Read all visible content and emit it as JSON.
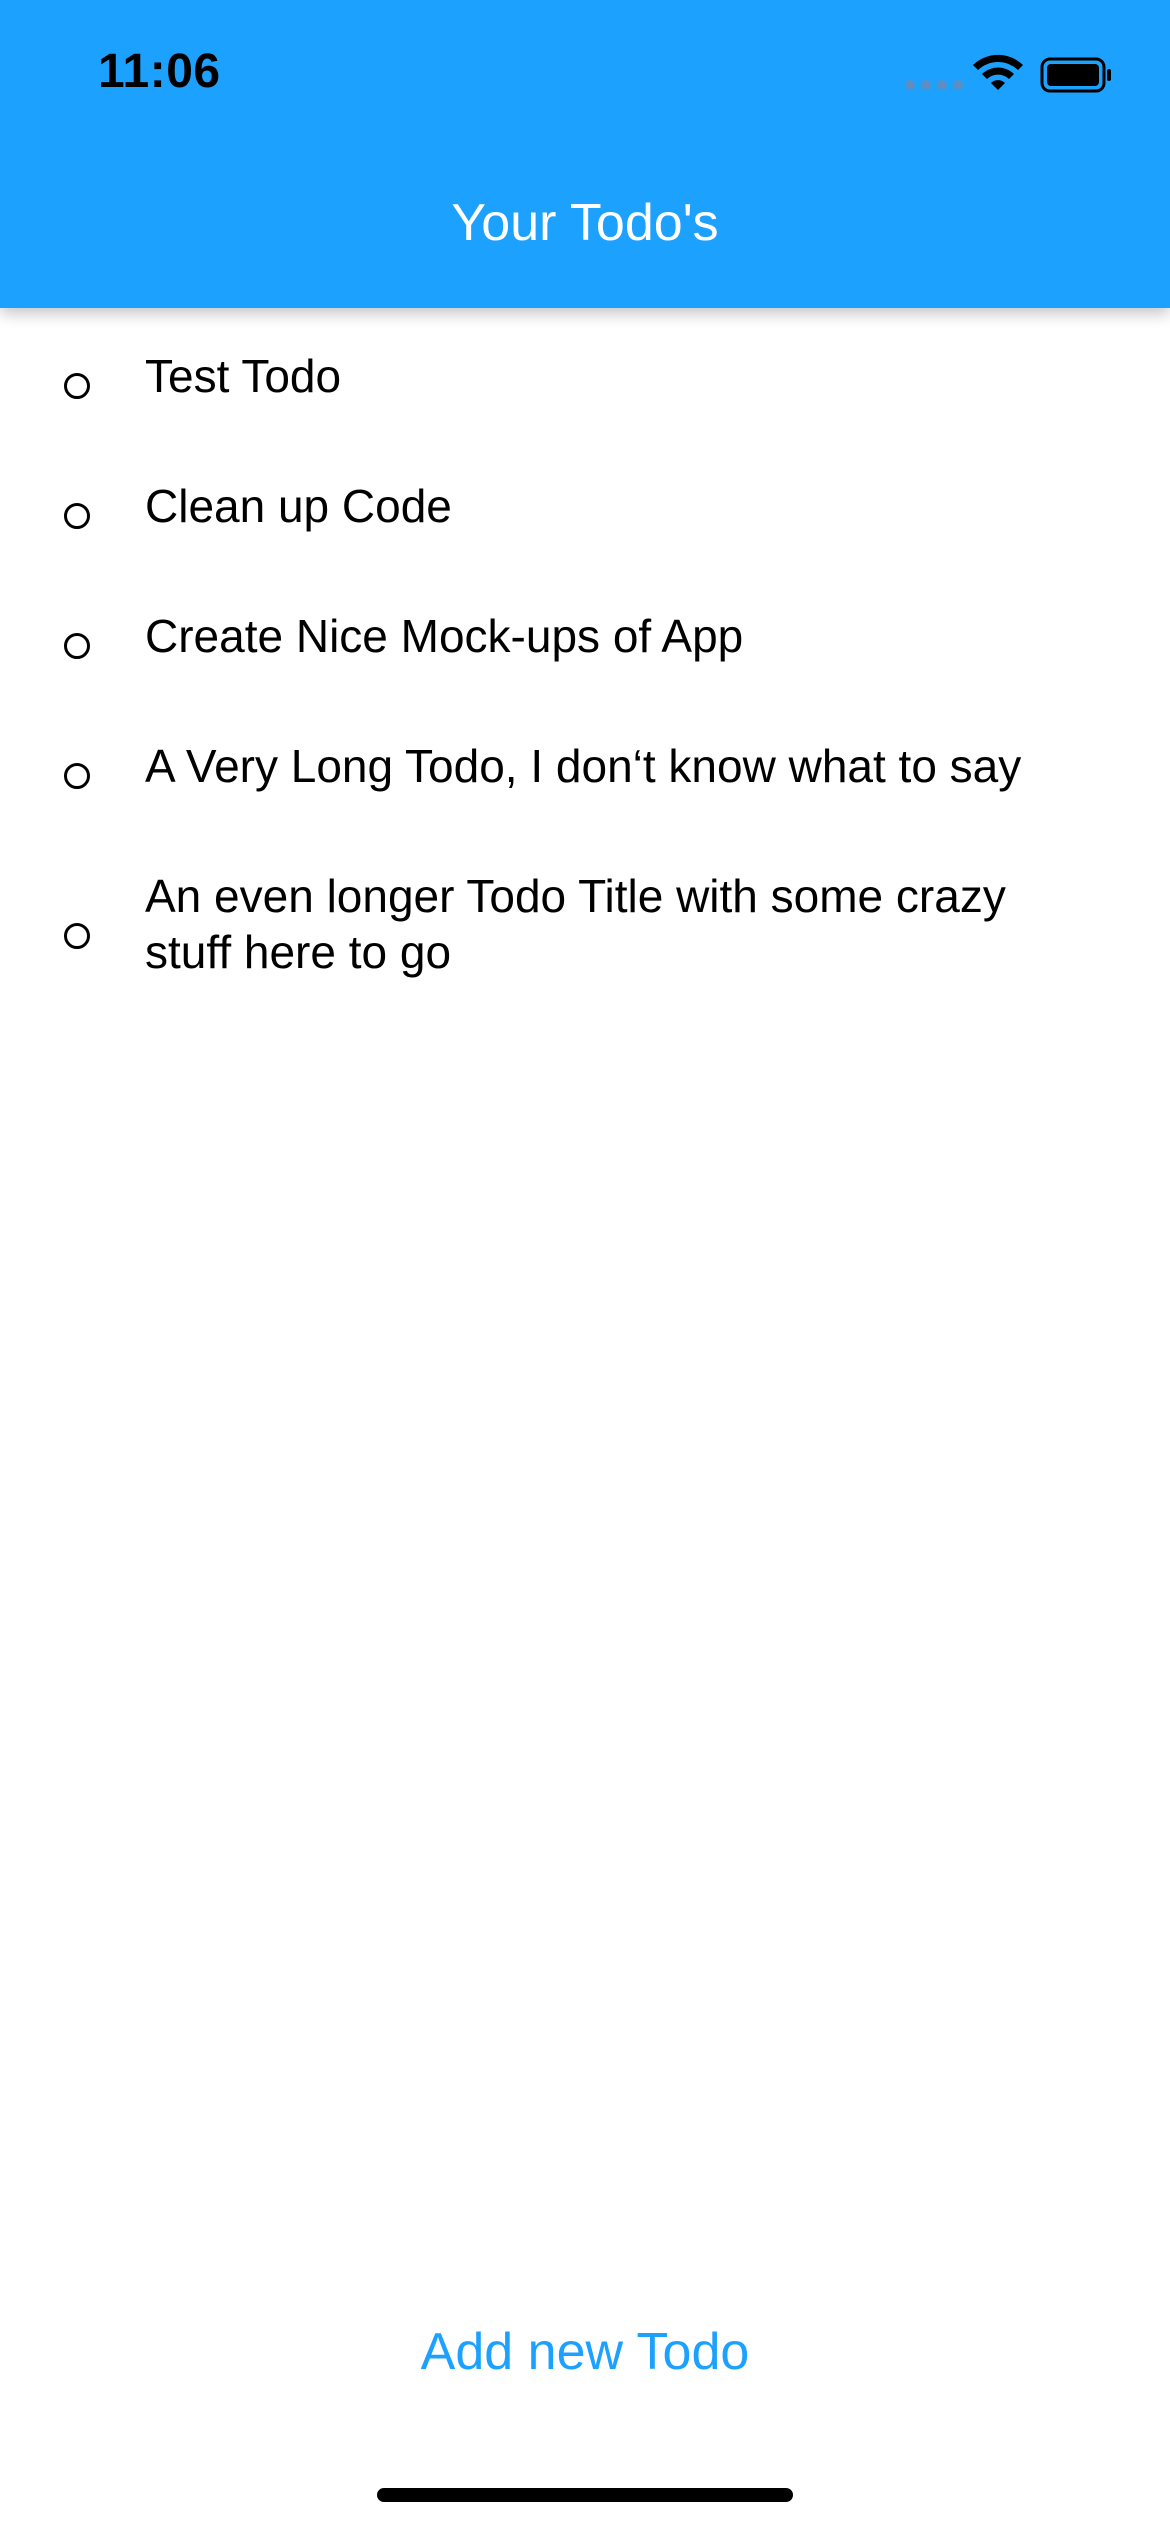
{
  "status_bar": {
    "time": "11:06"
  },
  "header": {
    "title": "Your Todo's",
    "background_color": "#1da1ff"
  },
  "todos": [
    {
      "title": "Test Todo",
      "completed": false
    },
    {
      "title": "Clean up Code",
      "completed": false
    },
    {
      "title": "Create Nice Mock-ups of App",
      "completed": false
    },
    {
      "title": "A Very Long Todo, I don‘t know what to say",
      "completed": false
    },
    {
      "title": "An even longer Todo Title with some crazy stuff here to go",
      "completed": false
    }
  ],
  "footer": {
    "add_button_label": "Add new Todo",
    "accent_color": "#1da1ff"
  },
  "icons": {
    "signal": "cellular-signal-icon",
    "wifi": "wifi-icon",
    "battery": "battery-icon",
    "todo_status": "radio-unchecked-icon"
  }
}
